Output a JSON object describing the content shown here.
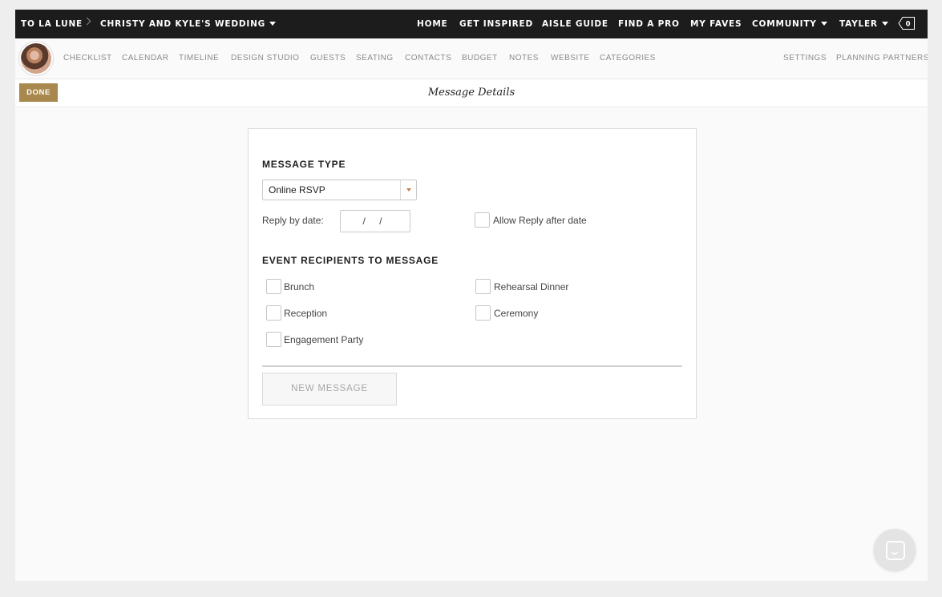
{
  "topnav": {
    "brand": "TO LA LUNE",
    "wedding": "CHRISTY AND KYLE'S WEDDING",
    "links": [
      "HOME",
      "GET INSPIRED",
      "AISLE GUIDE",
      "FIND A PRO",
      "MY FAVES"
    ],
    "community": "COMMUNITY",
    "user": "TAYLER",
    "tag_count": "0"
  },
  "subnav": {
    "items": [
      "CHECKLIST",
      "CALENDAR",
      "TIMELINE",
      "DESIGN STUDIO",
      "GUESTS",
      "SEATING",
      "CONTACTS",
      "BUDGET",
      "NOTES",
      "WEBSITE",
      "CATEGORIES"
    ],
    "right_items": [
      "SETTINGS",
      "PLANNING PARTNERS"
    ]
  },
  "toolbar": {
    "done_label": "DONE",
    "title": "Message Details"
  },
  "form": {
    "message_type_heading": "MESSAGE TYPE",
    "message_type_value": "Online RSVP",
    "reply_by_label": "Reply by date:",
    "reply_by_value": "/  /",
    "allow_reply_label": "Allow Reply after date",
    "recipients_heading": "EVENT RECIPIENTS TO MESSAGE",
    "events_left": [
      "Brunch",
      "Reception",
      "Engagement Party"
    ],
    "events_right": [
      "Rehearsal Dinner",
      "Ceremony"
    ],
    "new_message_label": "NEW MESSAGE"
  },
  "colors": {
    "topbar": "#1c1c1c",
    "accent": "#a8884d",
    "page_bg": "#fafafa"
  },
  "icons": {
    "chat": "chat-bubble-icon",
    "tag": "tag-icon"
  }
}
